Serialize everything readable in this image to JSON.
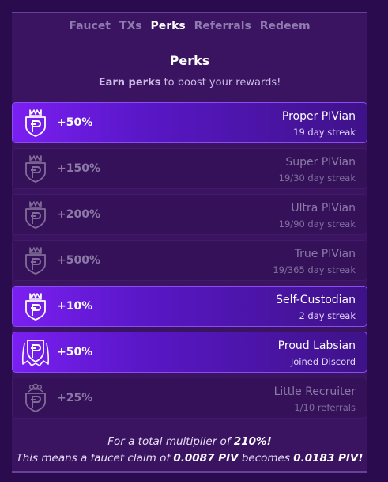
{
  "nav": {
    "tabs": [
      "Faucet",
      "TXs",
      "Perks",
      "Referrals",
      "Redeem"
    ],
    "active": "Perks"
  },
  "header": {
    "title": "Perks",
    "subtitle_bold": "Earn perks",
    "subtitle_rest": " to boost your rewards!"
  },
  "perks": [
    {
      "bonus": "+50%",
      "name": "Proper PIVian",
      "detail": "19 day streak",
      "active": true,
      "icon": "shield-crown-icon"
    },
    {
      "bonus": "+150%",
      "name": "Super PIVian",
      "detail": "19/30 day streak",
      "active": false,
      "icon": "shield-crown-icon"
    },
    {
      "bonus": "+200%",
      "name": "Ultra PIVian",
      "detail": "19/90 day streak",
      "active": false,
      "icon": "shield-crown-icon"
    },
    {
      "bonus": "+500%",
      "name": "True PIVian",
      "detail": "19/365 day streak",
      "active": false,
      "icon": "shield-crown-icon"
    },
    {
      "bonus": "+10%",
      "name": "Self-Custodian",
      "detail": "2 day streak",
      "active": true,
      "icon": "shield-crown-icon"
    },
    {
      "bonus": "+50%",
      "name": "Proud Labsian",
      "detail": "Joined Discord",
      "active": true,
      "icon": "caped-shield-icon"
    },
    {
      "bonus": "+25%",
      "name": "Little Recruiter",
      "detail": "1/10 referrals",
      "active": false,
      "icon": "shield-people-icon"
    }
  ],
  "summary": {
    "line1_prefix": "For a total multiplier of ",
    "multiplier": "210%!",
    "line2_prefix": "This means a faucet claim of ",
    "claim": "0.0087 PIV",
    "line2_mid": " becomes ",
    "result": "0.0183 PIV!"
  }
}
